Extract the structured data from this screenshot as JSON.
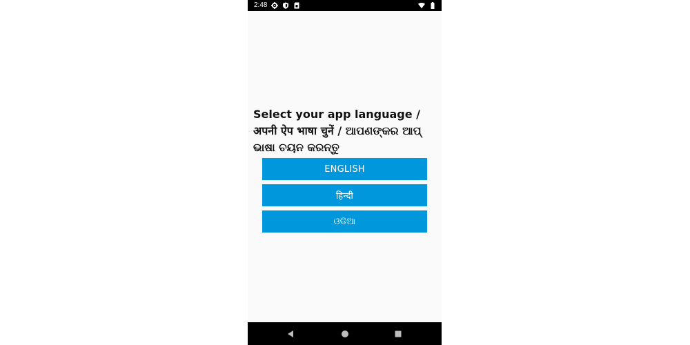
{
  "status_bar": {
    "time": "2:48",
    "icons_left": [
      "gear-icon",
      "shield-icon",
      "sim-card-icon"
    ],
    "icons_right": [
      "wifi-icon",
      "battery-icon"
    ]
  },
  "main": {
    "title": "Select your app language / अपनी ऐप भाषा चुनें / ଆପଣଙ୍କର ଆପ୍ ଭାଷା ଚୟନ କରନ୍ତୁ",
    "buttons": [
      {
        "label": "ENGLISH"
      },
      {
        "label": "हिन्दी"
      },
      {
        "label": "ଓଡିଆ"
      }
    ],
    "button_color": "#0097dd"
  },
  "nav_bar": {
    "icons": [
      "back-icon",
      "home-icon",
      "recent-apps-icon"
    ]
  }
}
